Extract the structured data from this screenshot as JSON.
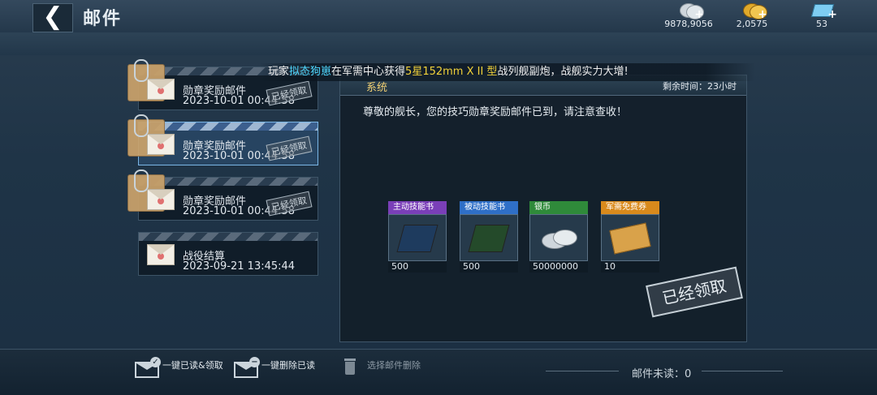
{
  "header": {
    "back_symbol": "❮",
    "title": "邮件",
    "currencies": [
      {
        "name": "silver-coins-icon",
        "value": "9878,9056",
        "plus": "+",
        "color": "#c9d0d6"
      },
      {
        "name": "gold-coins-icon",
        "value": "2,0575",
        "plus": "+",
        "color": "#e8b232"
      },
      {
        "name": "diamond-icon",
        "value": "53",
        "plus": "+",
        "color": "#78c8f0"
      }
    ]
  },
  "ticker": {
    "prefix": "玩家",
    "player": "拟态狗崽",
    "middle": "在军需中心获得",
    "item": "5星152mm X II 型",
    "suffix": "战列舰副炮，战舰实力大增!"
  },
  "mail_list": [
    {
      "subject": "勋章奖励邮件",
      "date": "2023-10-01 00:44:58",
      "stamp": "已经领取",
      "selected": false
    },
    {
      "subject": "勋章奖励邮件",
      "date": "2023-10-01 00:44:58",
      "stamp": "已经领取",
      "selected": true
    },
    {
      "subject": "勋章奖励邮件",
      "date": "2023-10-01 00:44:58",
      "stamp": "已经领取",
      "selected": false
    },
    {
      "subject": "战役结算",
      "date": "2023-09-21 13:45:44",
      "stamp": "",
      "selected": false
    }
  ],
  "detail": {
    "sender": "系统",
    "remaining": "剩余时间：23小时",
    "body": "尊敬的舰长，您的技巧勋章奖励邮件已到，请注意查收！",
    "attachments": [
      {
        "label": "主动技能书",
        "count": "500",
        "label_color": "#7a3fb8",
        "icon": "active-skill-book-icon"
      },
      {
        "label": "被动技能书",
        "count": "500",
        "label_color": "#2f6fc7",
        "icon": "passive-skill-book-icon"
      },
      {
        "label": "银币",
        "count": "50000000",
        "label_color": "#2f8a3a",
        "icon": "silver-coin-icon"
      },
      {
        "label": "军需免费券",
        "count": "10",
        "label_color": "#d98a1c",
        "icon": "supply-ticket-icon"
      }
    ],
    "claimed_stamp": "已经领取"
  },
  "footer": {
    "read_claim_all": "一键已读&领取",
    "delete_read": "一键删除已读",
    "select_delete": "选择邮件删除",
    "unread": "邮件未读：0"
  }
}
